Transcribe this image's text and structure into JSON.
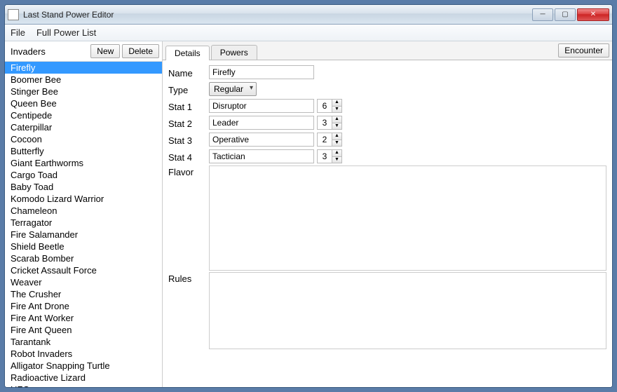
{
  "window": {
    "title": "Last Stand Power Editor"
  },
  "menu": {
    "file": "File",
    "full_power_list": "Full Power List"
  },
  "sidebar": {
    "title": "Invaders",
    "new_btn": "New",
    "delete_btn": "Delete",
    "selected_index": 0,
    "items": [
      "Firefly",
      "Boomer Bee",
      "Stinger Bee",
      "Queen Bee",
      "Centipede",
      "Caterpillar",
      "Cocoon",
      "Butterfly",
      "Giant Earthworms",
      "Cargo Toad",
      "Baby Toad",
      "Komodo Lizard Warrior",
      "Chameleon",
      "Terragator",
      "Fire Salamander",
      "Shield Beetle",
      "Scarab Bomber",
      "Cricket Assault Force",
      "Weaver",
      "The Crusher",
      "Fire Ant Drone",
      "Fire Ant Worker",
      "Fire Ant Queen",
      "Tarantank",
      "Robot Invaders",
      "Alligator Snapping Turtle",
      "Radioactive Lizard",
      "UFO"
    ]
  },
  "tabs": {
    "details": "Details",
    "powers": "Powers",
    "encounter": "Encounter"
  },
  "details": {
    "labels": {
      "name": "Name",
      "type": "Type",
      "stat1": "Stat 1",
      "stat2": "Stat 2",
      "stat3": "Stat 3",
      "stat4": "Stat 4",
      "flavor": "Flavor",
      "rules": "Rules"
    },
    "name": "Firefly",
    "type": "Regular",
    "stats": [
      {
        "name": "Disruptor",
        "value": "6"
      },
      {
        "name": "Leader",
        "value": "3"
      },
      {
        "name": "Operative",
        "value": "2"
      },
      {
        "name": "Tactician",
        "value": "3"
      }
    ],
    "flavor": "",
    "rules": ""
  }
}
